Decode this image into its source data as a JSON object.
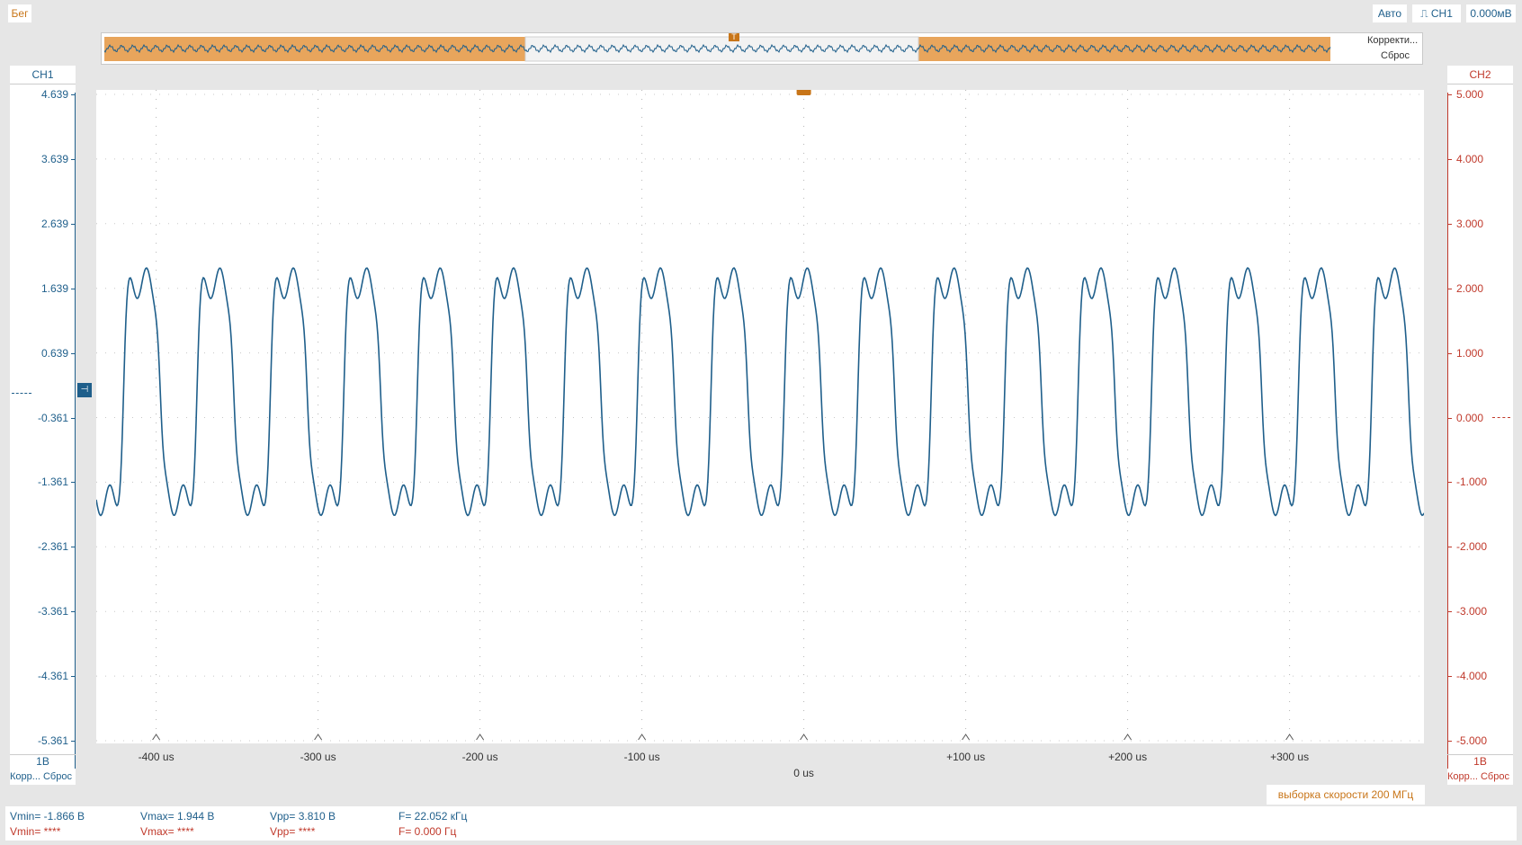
{
  "status": {
    "run_label": "Бег"
  },
  "toolbar": {
    "mode": "Авто",
    "trigger_channel": "CH1",
    "trigger_level": "0.000мВ"
  },
  "overview": {
    "correct_label": "Корректи...",
    "reset_label": "Сброс"
  },
  "left_axis": {
    "channel": "CH1",
    "scale": "1В",
    "footer": "Корр... Сброс",
    "ticks": [
      "4.639",
      "3.639",
      "2.639",
      "1.639",
      "0.639",
      "-0.361",
      "-1.361",
      "-2.361",
      "-3.361",
      "-4.361",
      "-5.361"
    ]
  },
  "right_axis": {
    "channel": "CH2",
    "scale": "1В",
    "footer": "Корр... Сброс",
    "ticks": [
      "5.000",
      "4.000",
      "3.000",
      "2.000",
      "1.000",
      "0.000",
      "-1.000",
      "-2.000",
      "-3.000",
      "-4.000",
      "-5.000"
    ]
  },
  "sample_rate": "выборка скорости 200 МГц",
  "measurements": {
    "ch1": {
      "vmin": "Vmin= -1.866 В",
      "vmax": "Vmax= 1.944 В",
      "vpp": "Vpp= 3.810 В",
      "freq": "F= 22.052 кГц"
    },
    "ch2": {
      "vmin": "Vmin= ****",
      "vmax": "Vmax= ****",
      "vpp": "Vpp= ****",
      "freq": "F= 0.000 Гц"
    }
  },
  "colors": {
    "ch1": "#1f5f8b",
    "ch2": "#c0392b",
    "trigger": "#c87518",
    "overview_fill": "#e8a55c"
  },
  "chart_data": {
    "type": "line",
    "x_tick_labels": [
      "-400 us",
      "-300 us",
      "-200 us",
      "-100 us",
      "0 us",
      "+100 us",
      "+200 us",
      "+300 us"
    ],
    "xlim": [
      -437,
      383
    ],
    "ylim": [
      -5.361,
      4.639
    ],
    "series": [
      {
        "name": "CH1",
        "vmin": -1.866,
        "vmax": 1.944,
        "frequency_khz": 22.052
      }
    ]
  }
}
